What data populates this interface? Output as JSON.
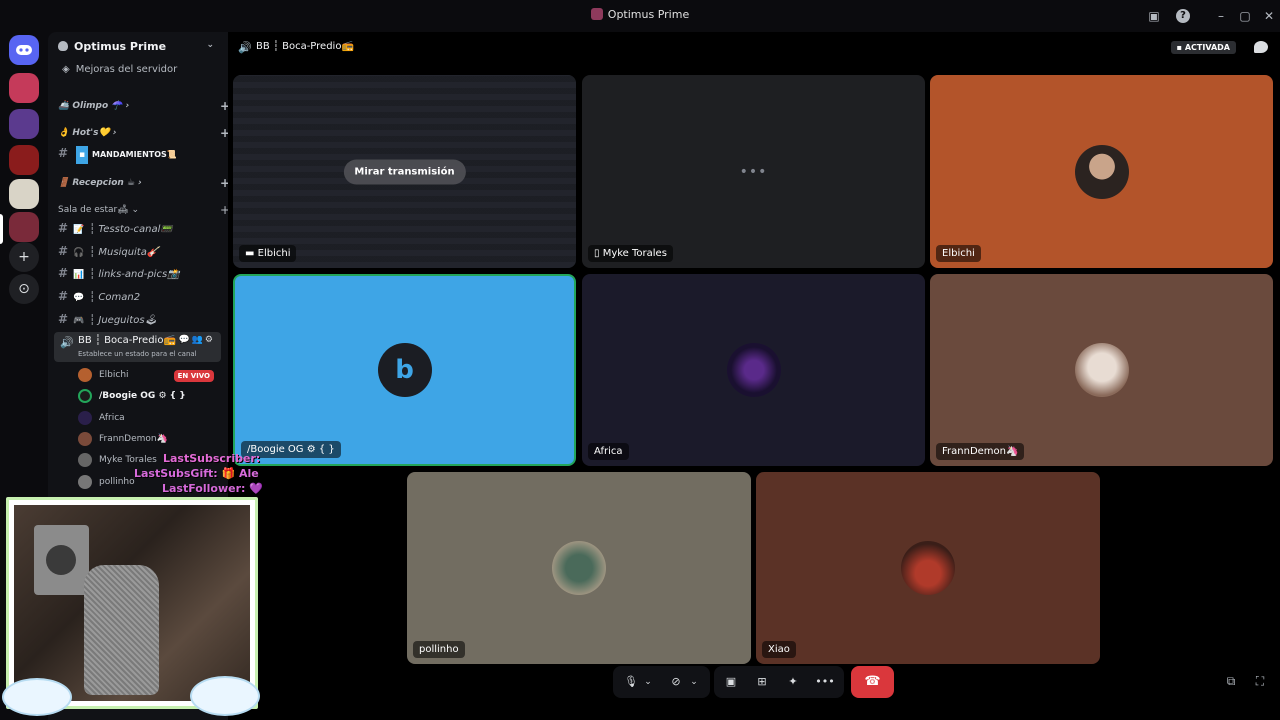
{
  "window": {
    "title": "Optimus Prime"
  },
  "servers": [
    {
      "name": "server-1",
      "color": "#c53a5a"
    },
    {
      "name": "server-2",
      "color": "#5b3a8e"
    },
    {
      "name": "server-3",
      "color": "#8a1c1c"
    },
    {
      "name": "server-4",
      "color": "#d9d4c7"
    },
    {
      "name": "server-5",
      "color": "#7a2a3a"
    }
  ],
  "sidebar": {
    "guild_name": "Optimus Prime",
    "boost_label": "Mejoras del servidor",
    "categories": [
      {
        "label": "🚢 Olimpo ☂️"
      },
      {
        "label": "👌 Hot's💛"
      },
      {
        "label": "🚪 Recepcion ☕"
      },
      {
        "label": "Sala de estar🛋"
      }
    ],
    "special_channel": {
      "label": "MANDAMIENTOS📜"
    },
    "channels": [
      {
        "label": "Tessto-canal📟",
        "emoji": "📝"
      },
      {
        "label": "Musiquita🎸",
        "emoji": "🎧"
      },
      {
        "label": "links-and-pics📸",
        "emoji": "📊"
      },
      {
        "label": "Coman2",
        "emoji": "💬"
      },
      {
        "label": "Jueguitos🕹",
        "emoji": "🎮"
      }
    ],
    "voice_channel": {
      "name": "BB ┆ Boca-Predio📻",
      "status": "Establece un estado para el canal"
    },
    "voice_users": [
      {
        "name": "Elbichi",
        "live": "EN VIVO",
        "color": "#b5602f"
      },
      {
        "name": "/Boogie OG ⚙ { }",
        "color": "#1e6bd6"
      },
      {
        "name": "Africa",
        "color": "#2a1f4a"
      },
      {
        "name": "FrannDemon🦄",
        "color": "#7a4a3a"
      },
      {
        "name": "Myke Torales",
        "color": "#666"
      },
      {
        "name": "pollinho",
        "color": "#777"
      }
    ]
  },
  "header": {
    "channel_title": "BB ┆ Boca-Predio📻",
    "activada": "ACTIVADA"
  },
  "tiles": [
    {
      "label": "Elbichi",
      "button": "Mirar transmisión",
      "bg": "#1e2026"
    },
    {
      "label": "Myke Torales",
      "bg": "#1e1f22"
    },
    {
      "label": "Elbichi",
      "bg": "#b3542a"
    },
    {
      "label": "/Boogie OG ⚙ { }",
      "bg": "#3ea5e6"
    },
    {
      "label": "Africa",
      "bg": "#1b1a2a"
    },
    {
      "label": "FrannDemon🦄",
      "bg": "#6a4a3d"
    },
    {
      "label": "pollinho",
      "bg": "#726d61"
    },
    {
      "label": "Xiao",
      "bg": "#5b3226"
    }
  ],
  "overlay": {
    "last_sub": "LastSubscriber:",
    "last_gift": "LastSubsGift: 🎁 Ale",
    "last_follower": "LastFollower: 💜"
  }
}
